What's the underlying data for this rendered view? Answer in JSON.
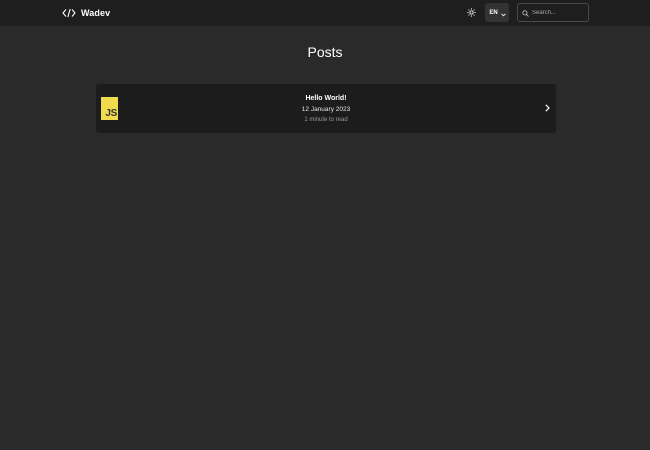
{
  "header": {
    "brand": "Wadev",
    "language": "EN",
    "search_placeholder": "Search..."
  },
  "page": {
    "title": "Posts"
  },
  "posts": [
    {
      "title": "Hello World!",
      "date": "12 January 2023",
      "read_time": "1 minute to read",
      "logo_text": "JS",
      "logo_color": "#f0db4f"
    }
  ],
  "icons": {
    "brand": "code-icon",
    "theme": "sun-icon",
    "language_dropdown": "chevron-down-icon",
    "search": "search-icon",
    "post_open": "chevron-right-icon"
  }
}
